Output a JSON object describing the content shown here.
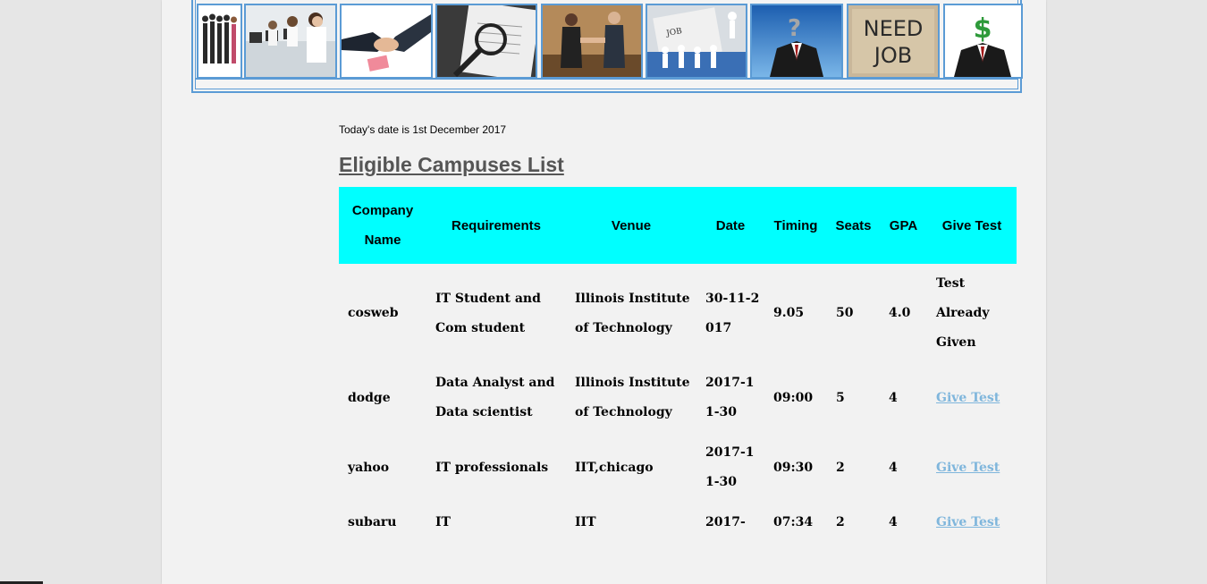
{
  "banner": {
    "images": [
      {
        "icon": "business-people-lineup-image"
      },
      {
        "icon": "call-center-agents-image"
      },
      {
        "icon": "handshake-image"
      },
      {
        "icon": "magnifier-document-image"
      },
      {
        "icon": "office-handshake-image"
      },
      {
        "icon": "job-market-paper-people-image"
      },
      {
        "icon": "question-mark-head-suit-image"
      },
      {
        "icon": "need-job-sign-image",
        "text": "NEED JOB"
      },
      {
        "icon": "dollar-head-suit-image",
        "text": "$"
      }
    ]
  },
  "date_line": "Today's date is 1st December 2017",
  "page_title": "Eligible Campuses List",
  "table": {
    "header_bg": "#00ffff",
    "columns": [
      "Company Name",
      "Requirements",
      "Venue",
      "Date",
      "Timing",
      "Seats",
      "GPA",
      "Give Test"
    ],
    "rows": [
      {
        "company": "cosweb",
        "requirements": "IT Student and Com student",
        "venue": "Illinois Institute of Technology",
        "date": "30-11-2017",
        "timing": "9.05",
        "seats": "50",
        "gpa": "4.0",
        "give_test": "Test Already Given",
        "is_link": false
      },
      {
        "company": "dodge",
        "requirements": "Data Analyst and Data scientist",
        "venue": "Illinois Institute of Technology",
        "date": "2017-11-30",
        "timing": "09:00",
        "seats": "5",
        "gpa": "4",
        "give_test": "Give Test",
        "is_link": true
      },
      {
        "company": "yahoo",
        "requirements": "IT professionals",
        "venue": "IIT,chicago",
        "date": "2017-11-30",
        "timing": "09:30",
        "seats": "2",
        "gpa": "4",
        "give_test": "Give Test",
        "is_link": true
      },
      {
        "company": "subaru",
        "requirements": "IT",
        "venue": "IIT",
        "date": "2017-",
        "timing": "07:34",
        "seats": "2",
        "gpa": "4",
        "give_test": "Give Test",
        "is_link": true
      }
    ]
  }
}
